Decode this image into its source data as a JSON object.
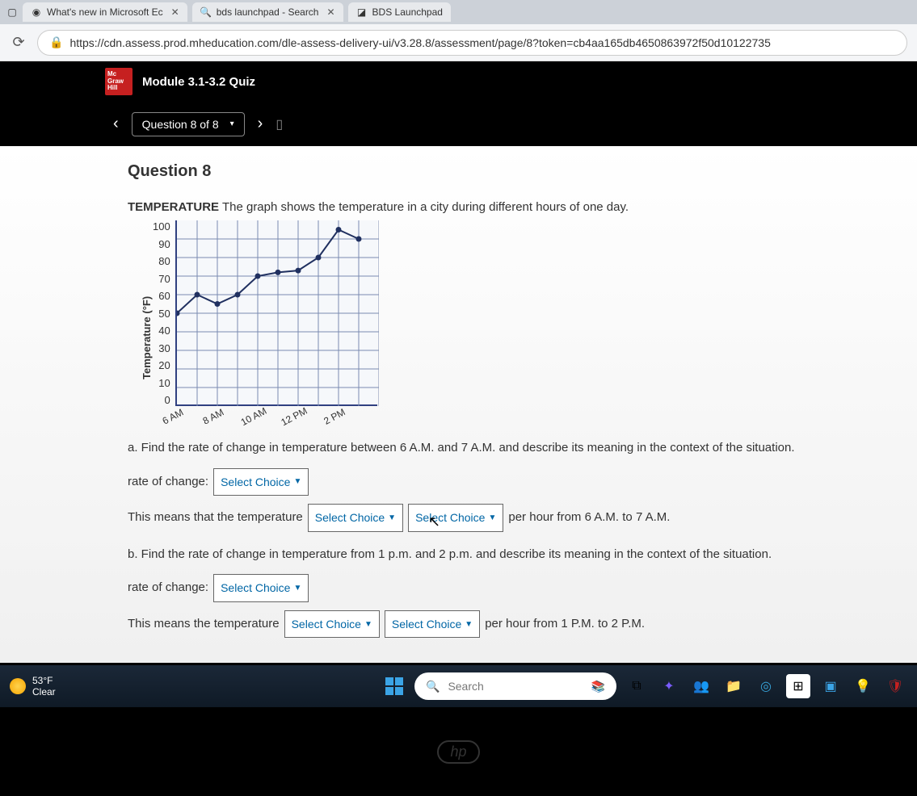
{
  "tabs": [
    {
      "label": "What's new in Microsoft Ec"
    },
    {
      "label": "bds launchpad - Search"
    },
    {
      "label": "BDS Launchpad"
    }
  ],
  "url": "https://cdn.assess.prod.mheducation.com/dle-assess-delivery-ui/v3.28.8/assessment/page/8?token=cb4aa165db4650863972f50d10122735",
  "logo_lines": {
    "l1": "Mc",
    "l2": "Graw",
    "l3": "Hill"
  },
  "module_title": "Module 3.1-3.2 Quiz",
  "question_nav": "Question 8 of 8",
  "question_title": "Question 8",
  "prompt_bold": "TEMPERATURE",
  "prompt_rest": " The graph shows the temperature in a city during different hours of one day.",
  "part_a": "a. Find the rate of change in temperature between 6 A.M. and 7 A.M. and describe its meaning in the context of the situation.",
  "a_line1_pre": "rate of change:",
  "a_line2_pre": "This means that the temperature",
  "a_line2_post": "per hour from 6 A.M. to 7 A.M.",
  "part_b": "b. Find the rate of change in temperature from 1 p.m. and 2 p.m. and describe its meaning in the context of the situation.",
  "b_line1_pre": "rate of change:",
  "b_line2_pre": "This means the temperature",
  "b_line2_post": "per hour from 1 P.M. to 2 P.M.",
  "select_label": "Select Choice",
  "weather": {
    "temp": "53°F",
    "cond": "Clear"
  },
  "search_placeholder": "Search",
  "chart_data": {
    "type": "line",
    "title": "",
    "xlabel": "",
    "ylabel": "Temperature (°F)",
    "ylim": [
      0,
      100
    ],
    "yticks": [
      100,
      90,
      80,
      70,
      60,
      50,
      40,
      30,
      20,
      10,
      0
    ],
    "categories": [
      "6 AM",
      "8 AM",
      "10 AM",
      "12 PM",
      "2 PM"
    ],
    "x_points": [
      "6 AM",
      "7 AM",
      "8 AM",
      "9 AM",
      "10 AM",
      "11 AM",
      "12 PM",
      "1 PM",
      "2 PM"
    ],
    "values": [
      50,
      60,
      55,
      60,
      70,
      72,
      73,
      80,
      95,
      90
    ]
  }
}
